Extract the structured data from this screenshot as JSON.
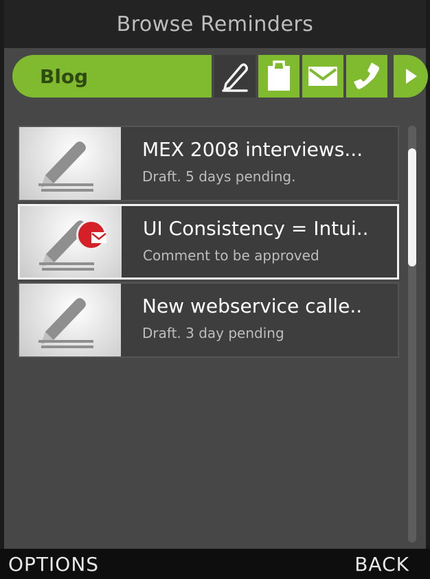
{
  "header": {
    "title": "Browse Reminders"
  },
  "tabs": {
    "active_label": "Blog",
    "icons": [
      "pen-icon",
      "clipboard-icon",
      "envelope-icon",
      "phone-icon",
      "arrow-right-icon"
    ]
  },
  "colors": {
    "accent": "#7fba2f",
    "badge": "#d62027",
    "background": "#474747",
    "title_bar": "#232323"
  },
  "reminders": [
    {
      "title": "MEX 2008 interviews...",
      "subtitle": "Draft. 5 days pending.",
      "icon": "pen-icon",
      "badge": null,
      "selected": false
    },
    {
      "title": "UI Consistency = Intui..",
      "subtitle": "Comment to be approved",
      "icon": "pen-icon",
      "badge": "envelope-icon",
      "selected": true
    },
    {
      "title": "New webservice calle..",
      "subtitle": "Draft. 3 day pending",
      "icon": "pen-icon",
      "badge": null,
      "selected": false
    }
  ],
  "softkeys": {
    "left": "OPTIONS",
    "right": "BACK"
  }
}
